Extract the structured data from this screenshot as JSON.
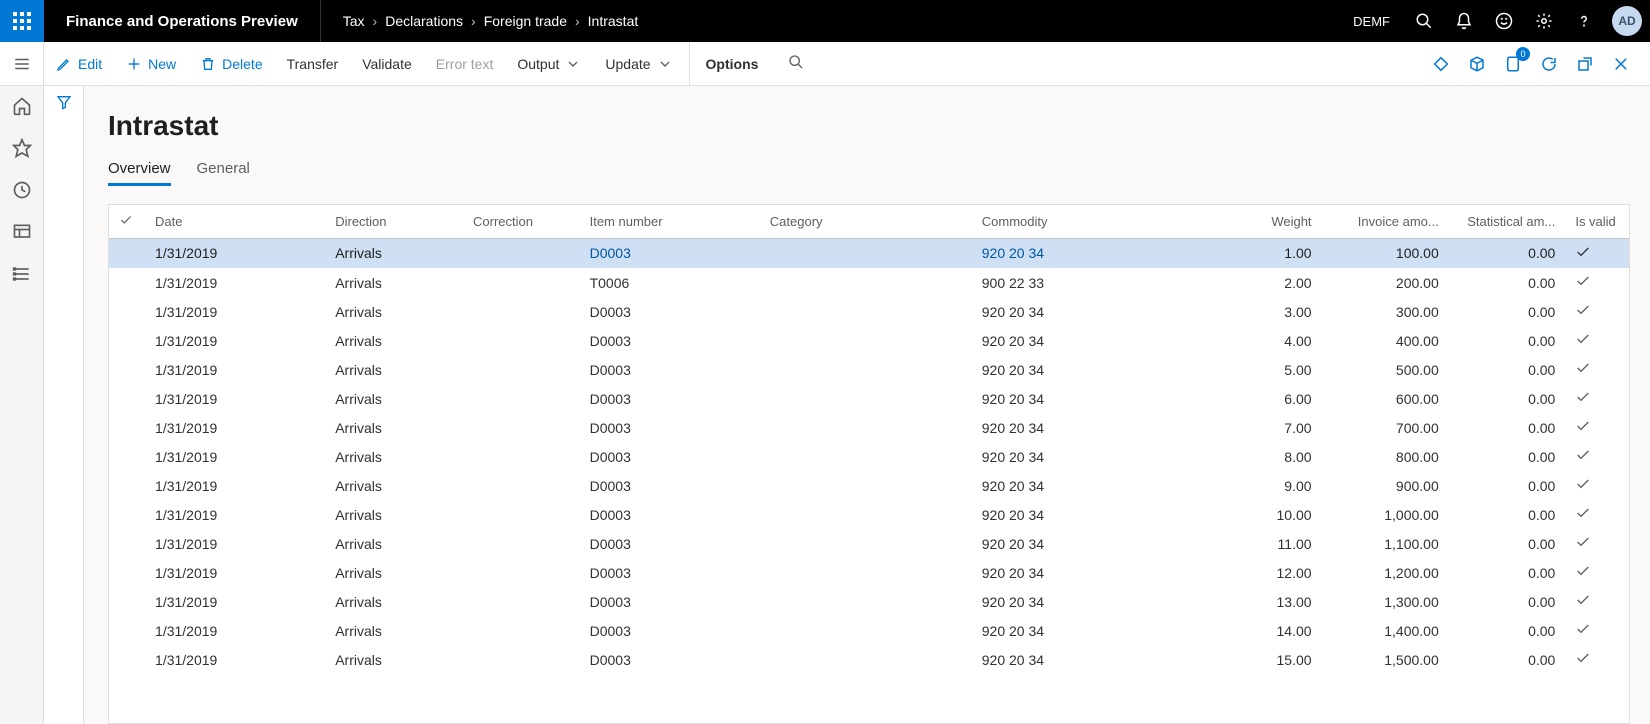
{
  "header": {
    "app_title": "Finance and Operations Preview",
    "legal_entity": "DEMF",
    "avatar_initials": "AD",
    "breadcrumb": [
      "Tax",
      "Declarations",
      "Foreign trade",
      "Intrastat"
    ]
  },
  "actions": {
    "edit": "Edit",
    "new": "New",
    "delete": "Delete",
    "transfer": "Transfer",
    "validate": "Validate",
    "error_text": "Error text",
    "output": "Output",
    "update": "Update",
    "options": "Options",
    "badge_count": "0"
  },
  "page": {
    "title": "Intrastat",
    "tabs": {
      "overview": "Overview",
      "general": "General"
    }
  },
  "grid": {
    "headers": {
      "date": "Date",
      "direction": "Direction",
      "correction": "Correction",
      "item": "Item number",
      "category": "Category",
      "commodity": "Commodity",
      "weight": "Weight",
      "invoice": "Invoice amo...",
      "statistical": "Statistical am...",
      "valid": "Is valid"
    },
    "rows": [
      {
        "date": "1/31/2019",
        "direction": "Arrivals",
        "correction": "",
        "item": "D0003",
        "category": "",
        "commodity": "920 20 34",
        "weight": "1.00",
        "invoice": "100.00",
        "stat": "0.00",
        "valid": true,
        "selected": true
      },
      {
        "date": "1/31/2019",
        "direction": "Arrivals",
        "correction": "",
        "item": "T0006",
        "category": "",
        "commodity": "900 22 33",
        "weight": "2.00",
        "invoice": "200.00",
        "stat": "0.00",
        "valid": true
      },
      {
        "date": "1/31/2019",
        "direction": "Arrivals",
        "correction": "",
        "item": "D0003",
        "category": "",
        "commodity": "920 20 34",
        "weight": "3.00",
        "invoice": "300.00",
        "stat": "0.00",
        "valid": true
      },
      {
        "date": "1/31/2019",
        "direction": "Arrivals",
        "correction": "",
        "item": "D0003",
        "category": "",
        "commodity": "920 20 34",
        "weight": "4.00",
        "invoice": "400.00",
        "stat": "0.00",
        "valid": true
      },
      {
        "date": "1/31/2019",
        "direction": "Arrivals",
        "correction": "",
        "item": "D0003",
        "category": "",
        "commodity": "920 20 34",
        "weight": "5.00",
        "invoice": "500.00",
        "stat": "0.00",
        "valid": true
      },
      {
        "date": "1/31/2019",
        "direction": "Arrivals",
        "correction": "",
        "item": "D0003",
        "category": "",
        "commodity": "920 20 34",
        "weight": "6.00",
        "invoice": "600.00",
        "stat": "0.00",
        "valid": true
      },
      {
        "date": "1/31/2019",
        "direction": "Arrivals",
        "correction": "",
        "item": "D0003",
        "category": "",
        "commodity": "920 20 34",
        "weight": "7.00",
        "invoice": "700.00",
        "stat": "0.00",
        "valid": true
      },
      {
        "date": "1/31/2019",
        "direction": "Arrivals",
        "correction": "",
        "item": "D0003",
        "category": "",
        "commodity": "920 20 34",
        "weight": "8.00",
        "invoice": "800.00",
        "stat": "0.00",
        "valid": true
      },
      {
        "date": "1/31/2019",
        "direction": "Arrivals",
        "correction": "",
        "item": "D0003",
        "category": "",
        "commodity": "920 20 34",
        "weight": "9.00",
        "invoice": "900.00",
        "stat": "0.00",
        "valid": true
      },
      {
        "date": "1/31/2019",
        "direction": "Arrivals",
        "correction": "",
        "item": "D0003",
        "category": "",
        "commodity": "920 20 34",
        "weight": "10.00",
        "invoice": "1,000.00",
        "stat": "0.00",
        "valid": true
      },
      {
        "date": "1/31/2019",
        "direction": "Arrivals",
        "correction": "",
        "item": "D0003",
        "category": "",
        "commodity": "920 20 34",
        "weight": "11.00",
        "invoice": "1,100.00",
        "stat": "0.00",
        "valid": true
      },
      {
        "date": "1/31/2019",
        "direction": "Arrivals",
        "correction": "",
        "item": "D0003",
        "category": "",
        "commodity": "920 20 34",
        "weight": "12.00",
        "invoice": "1,200.00",
        "stat": "0.00",
        "valid": true
      },
      {
        "date": "1/31/2019",
        "direction": "Arrivals",
        "correction": "",
        "item": "D0003",
        "category": "",
        "commodity": "920 20 34",
        "weight": "13.00",
        "invoice": "1,300.00",
        "stat": "0.00",
        "valid": true
      },
      {
        "date": "1/31/2019",
        "direction": "Arrivals",
        "correction": "",
        "item": "D0003",
        "category": "",
        "commodity": "920 20 34",
        "weight": "14.00",
        "invoice": "1,400.00",
        "stat": "0.00",
        "valid": true
      },
      {
        "date": "1/31/2019",
        "direction": "Arrivals",
        "correction": "",
        "item": "D0003",
        "category": "",
        "commodity": "920 20 34",
        "weight": "15.00",
        "invoice": "1,500.00",
        "stat": "0.00",
        "valid": true
      }
    ]
  }
}
